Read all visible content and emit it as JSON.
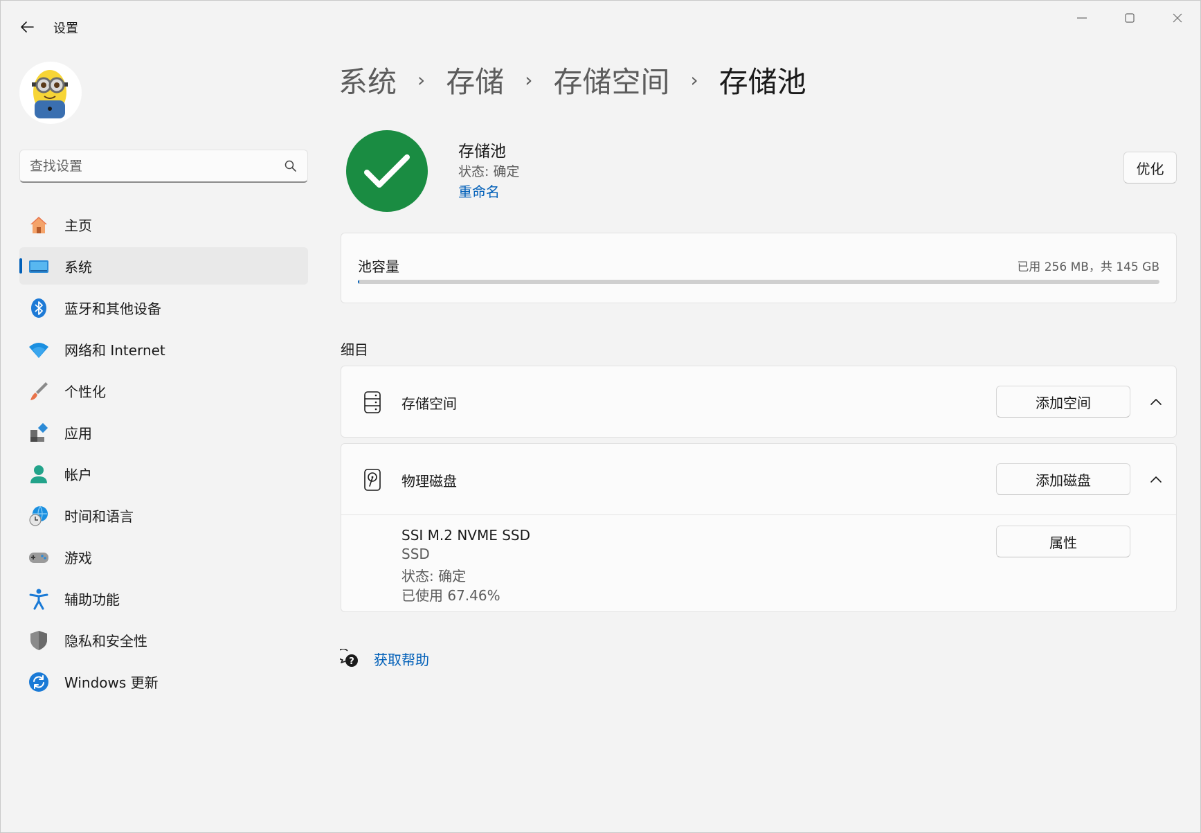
{
  "window": {
    "title": "设置",
    "controls": [
      "minimize-icon",
      "maximize-icon",
      "close-icon"
    ]
  },
  "search": {
    "placeholder": "查找设置"
  },
  "sidebar": {
    "items": [
      {
        "label": "主页",
        "icon": "home-icon"
      },
      {
        "label": "系统",
        "icon": "system-icon",
        "active": true
      },
      {
        "label": "蓝牙和其他设备",
        "icon": "bluetooth-icon"
      },
      {
        "label": "网络和 Internet",
        "icon": "wifi-icon"
      },
      {
        "label": "个性化",
        "icon": "brush-icon"
      },
      {
        "label": "应用",
        "icon": "apps-icon"
      },
      {
        "label": "帐户",
        "icon": "account-icon"
      },
      {
        "label": "时间和语言",
        "icon": "globe-clock-icon"
      },
      {
        "label": "游戏",
        "icon": "gamepad-icon"
      },
      {
        "label": "辅助功能",
        "icon": "accessibility-icon"
      },
      {
        "label": "隐私和安全性",
        "icon": "shield-icon"
      },
      {
        "label": "Windows 更新",
        "icon": "update-icon"
      }
    ]
  },
  "breadcrumb": {
    "items": [
      "系统",
      "存储",
      "存储空间",
      "存储池"
    ],
    "separator": "›"
  },
  "pool": {
    "title": "存储池",
    "status": "状态: 确定",
    "rename": "重命名",
    "optimize": "优化",
    "status_color": "#1a8c42"
  },
  "capacity": {
    "label": "池容量",
    "value": "已用 256 MB，共 145 GB",
    "used_fraction": 0.0017
  },
  "details": {
    "heading": "细目",
    "storage_spaces": {
      "label": "存储空间",
      "button": "添加空间"
    },
    "physical_disks": {
      "label": "物理磁盘",
      "button": "添加磁盘",
      "disks": [
        {
          "name": "SSI M.2 NVME SSD",
          "type": "SSD",
          "status": "状态: 确定",
          "used": "已使用 67.46%",
          "button": "属性"
        }
      ]
    }
  },
  "help": {
    "label": "获取帮助"
  },
  "colors": {
    "accent": "#005fb8",
    "background": "#f3f3f3",
    "card": "#fbfbfb"
  }
}
